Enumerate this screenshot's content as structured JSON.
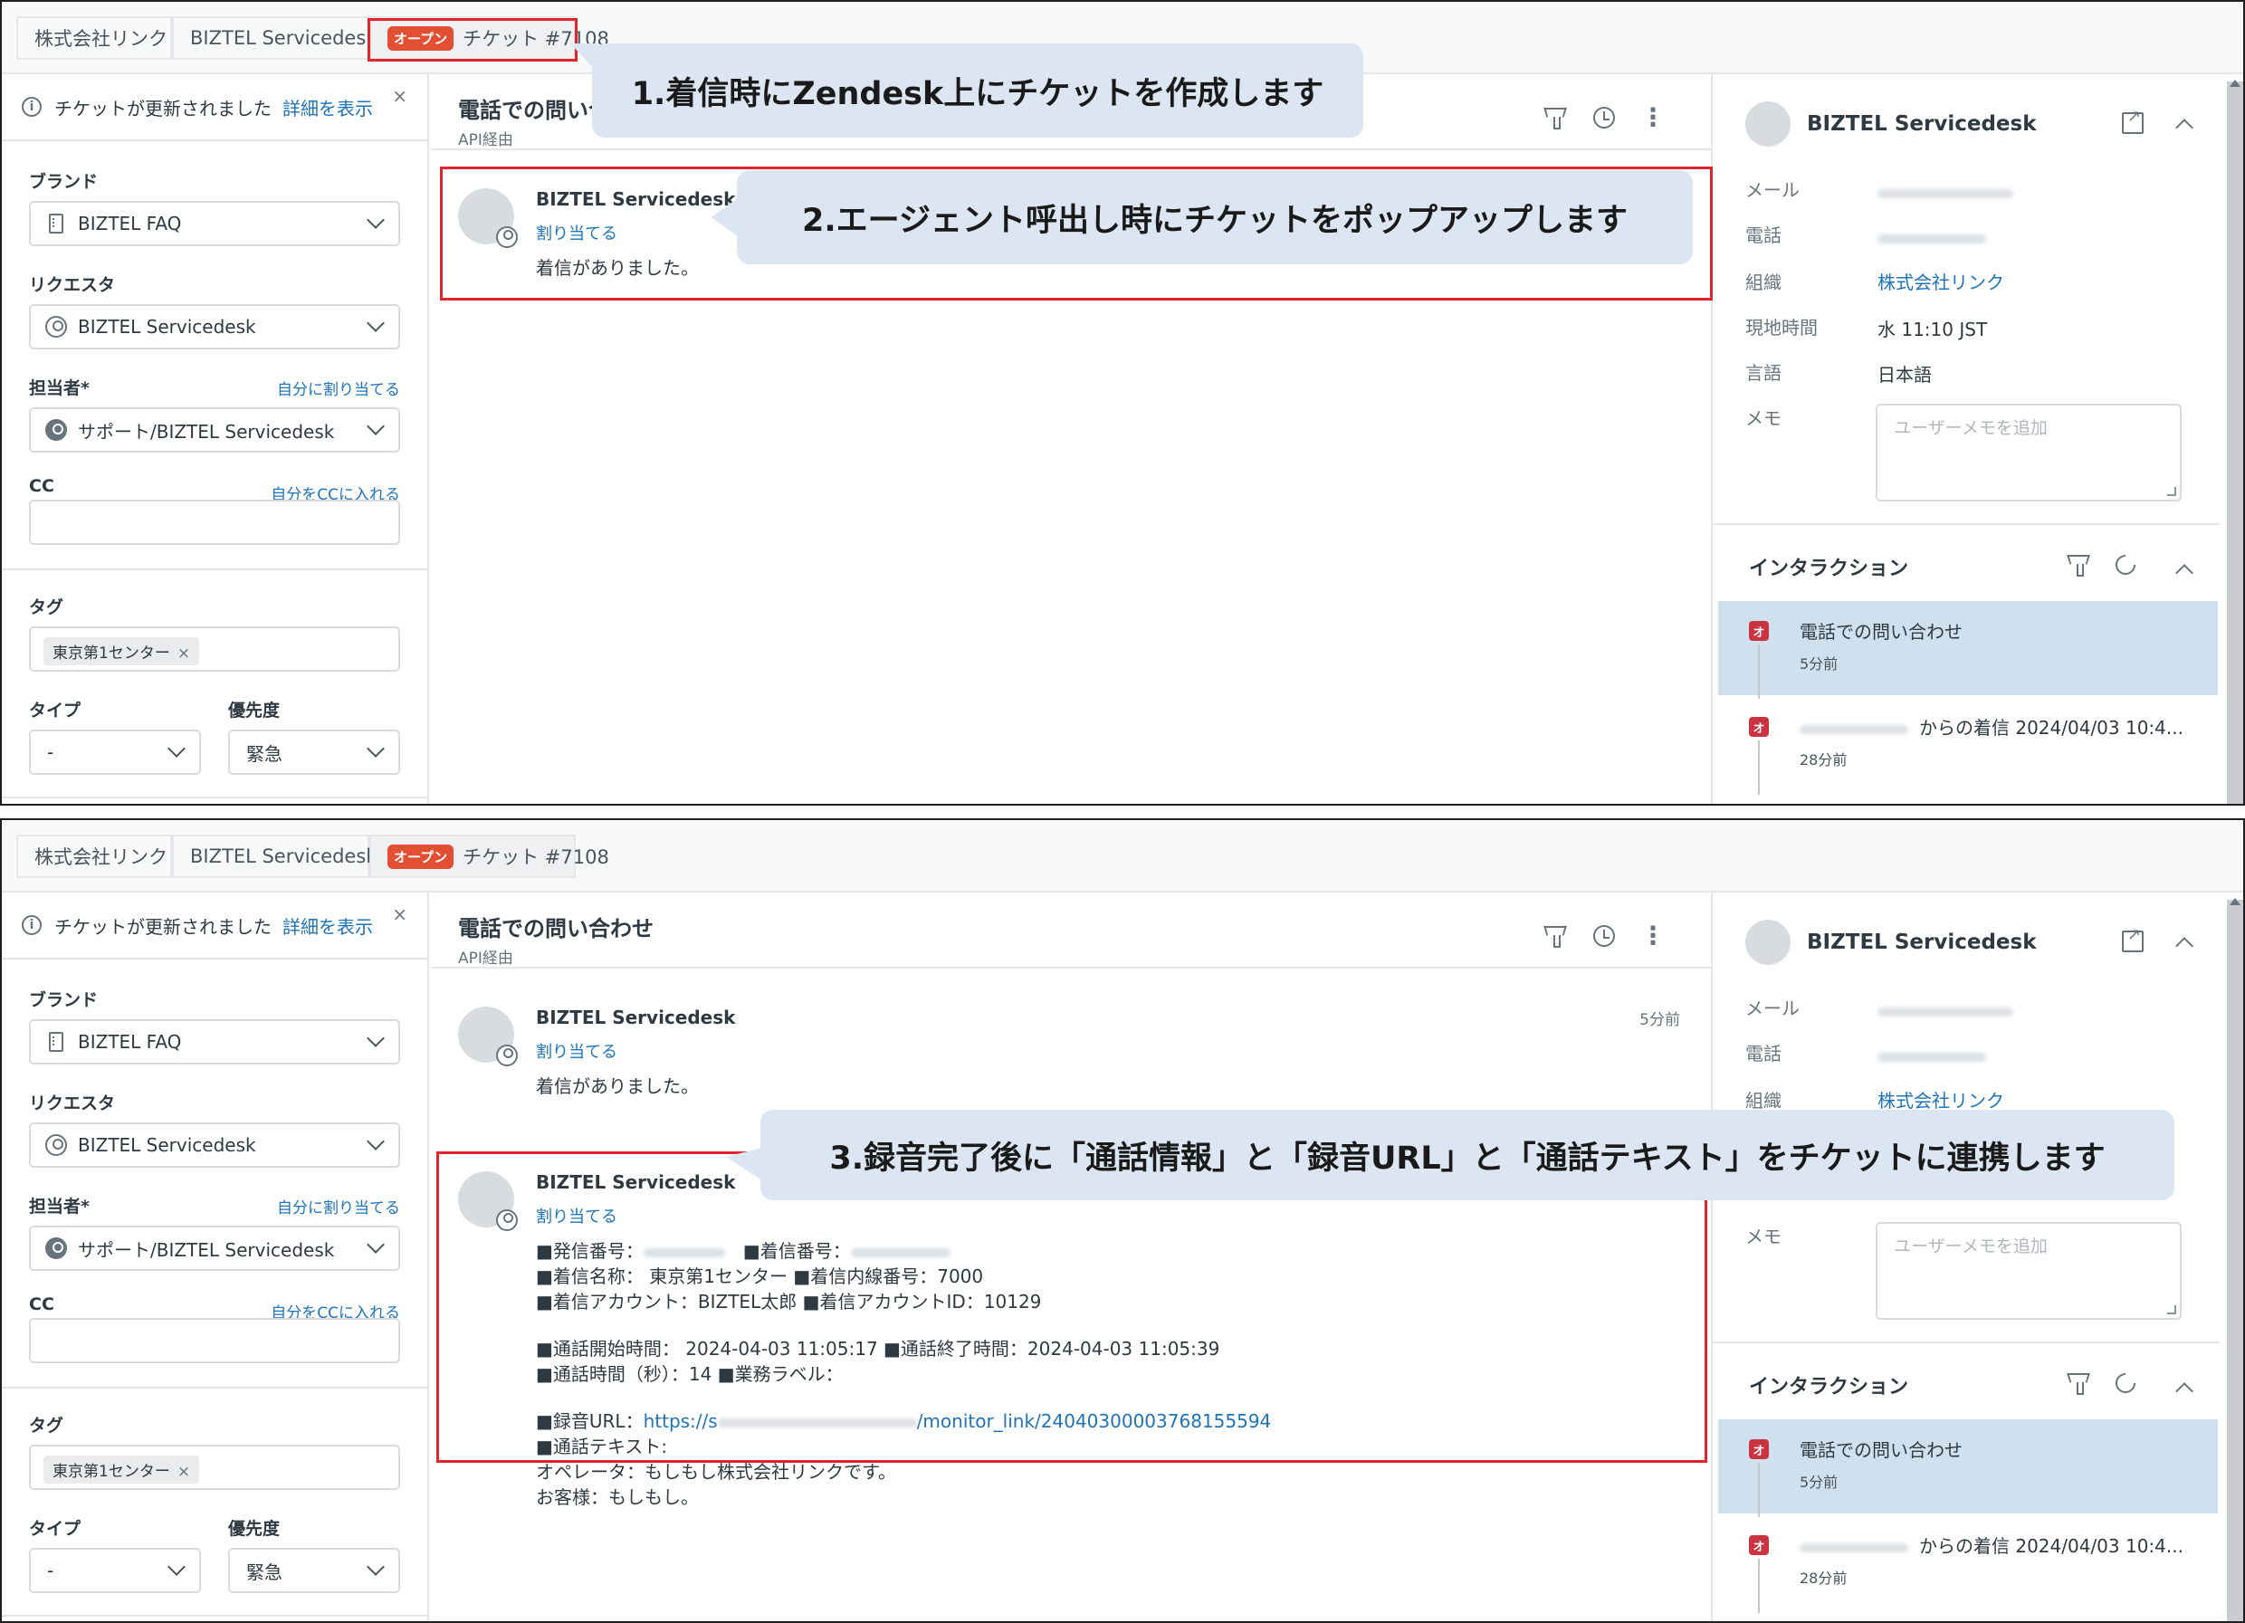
{
  "tabs": {
    "company": "株式会社リンク",
    "user": "BIZTEL Servicedesk",
    "ticket_badge": "オープン",
    "ticket": "チケット #7108"
  },
  "notice": {
    "text": "チケットが更新されました",
    "link": "詳細を表示",
    "close": "×"
  },
  "fields": {
    "brand_label": "ブランド",
    "brand_value": "BIZTEL FAQ",
    "requester_label": "リクエスタ",
    "requester_value": "BIZTEL Servicedesk",
    "assignee_label": "担当者*",
    "assignee_link": "自分に割り当てる",
    "assignee_value": "サポート/BIZTEL Servicedesk",
    "cc_label": "CC",
    "cc_link": "自分をCCに入れる",
    "tags_label": "タグ",
    "tag_value": "東京第1センター",
    "tag_remove": "×",
    "type_label": "タイプ",
    "type_value": "-",
    "priority_label": "優先度",
    "priority_value": "緊急"
  },
  "ticket": {
    "title": "電話での問い合わせ",
    "title_truncated": "電話での問い合",
    "via": "API経由",
    "kebab": "⋮"
  },
  "message1": {
    "author": "BIZTEL Servicedesk",
    "assign": "割り当てる",
    "body": "着信がありました。",
    "time": "5分前"
  },
  "message2": {
    "author": "BIZTEL Servicedesk",
    "assign": "割り当てる",
    "line_caller_label": "■発信番号：",
    "line_callee_label": "■着信番号：",
    "line_name": "■着信名称：  東京第1センター ■着信内線番号：7000",
    "line_account": "■着信アカウント：BIZTEL太郎    ■着信アカウントID：10129",
    "line_start": "■通話開始時間：  2024-04-03 11:05:17 ■通話終了時間：2024-04-03 11:05:39",
    "line_duration": "■通話時間（秒）：14     ■業務ラベル：",
    "line_url_label": "■録音URL：",
    "url_prefix": "https://s",
    "url_suffix": "/monitor_link/24040300003768155594",
    "line_text_label": "■通話テキスト:",
    "line_operator": "オペレータ：もしもし株式会社リンクです。",
    "line_customer": "お客様：もしもし。"
  },
  "right": {
    "name": "BIZTEL Servicedesk",
    "email_label": "メール",
    "phone_label": "電話",
    "org_label": "組織",
    "org_value": "株式会社リンク",
    "localtime_label": "現地時間",
    "localtime_value": "水 11:10 JST",
    "language_label": "言語",
    "language_value": "日本語",
    "memo_label": "メモ",
    "memo_placeholder": "ユーザーメモを追加",
    "interactions_title": "インタラクション",
    "item1_badge": "オ",
    "item1_title": "電話での問い合わせ",
    "item1_time": "5分前",
    "item2_badge": "オ",
    "item2_title": "からの着信 2024/04/03 10:4...",
    "item2_time": "28分前"
  },
  "annotations": {
    "step1": "1.着信時にZendesk上にチケットを作成します",
    "step2": "2.エージェント呼出し時にチケットをポップアップします",
    "step3": "3.録音完了後に「通話情報」と「録音URL」と「通話テキスト」をチケットに連携します"
  },
  "colors": {
    "accent": "#1f73b7",
    "open_badge": "#e34f32",
    "highlight_border": "#e0262c",
    "callout_bg": "#dce6f2",
    "interaction_active": "#cfe1ef"
  }
}
